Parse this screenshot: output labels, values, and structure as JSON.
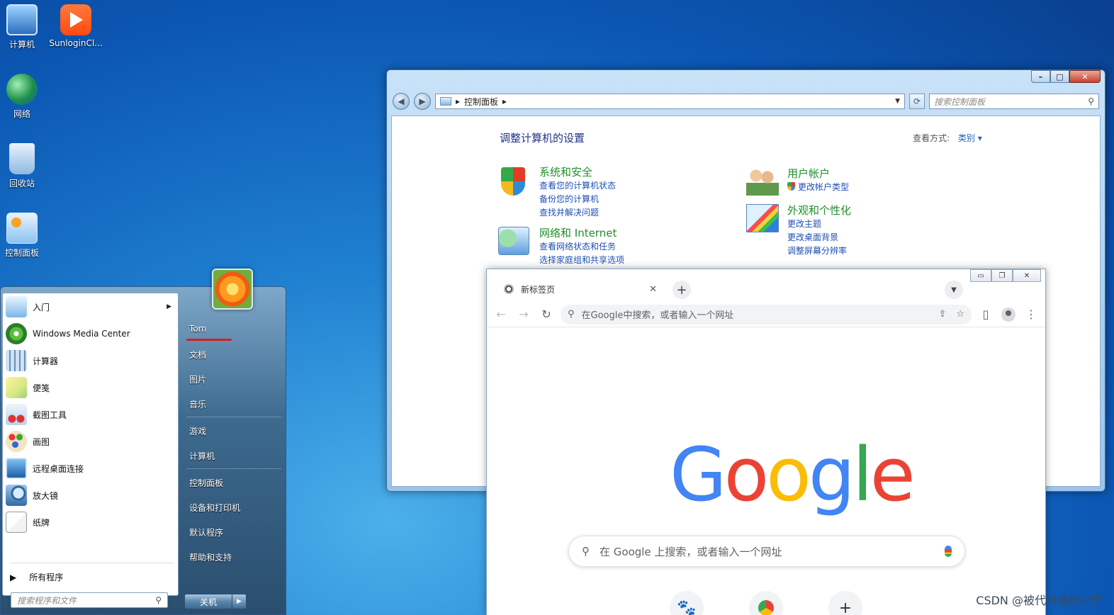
{
  "desktop": {
    "icons": [
      {
        "label": "计算机"
      },
      {
        "label": "SunloginCl..."
      },
      {
        "label": "网络"
      },
      {
        "label": "回收站"
      },
      {
        "label": "控制面板"
      }
    ]
  },
  "control_panel": {
    "breadcrumb": "控制面板",
    "search_placeholder": "搜索控制面板",
    "title": "调整计算机的设置",
    "view_by_label": "查看方式:",
    "view_by_value": "类别",
    "categories": [
      {
        "title": "系统和安全",
        "links": [
          "查看您的计算机状态",
          "备份您的计算机",
          "查找并解决问题"
        ]
      },
      {
        "title": "网络和 Internet",
        "links": [
          "查看网络状态和任务",
          "选择家庭组和共享选项"
        ]
      },
      {
        "title": "用户帐户",
        "links": [
          "更改帐户类型"
        ]
      },
      {
        "title": "外观和个性化",
        "links": [
          "更改主题",
          "更改桌面背景",
          "调整屏幕分辨率"
        ]
      }
    ]
  },
  "chrome": {
    "tab_title": "新标签页",
    "omnibox_placeholder": "在Google中搜索，或者输入一个网址",
    "logo_letters": [
      "G",
      "o",
      "o",
      "g",
      "l",
      "e"
    ],
    "search_placeholder": "在 Google 上搜索，或者输入一个网址"
  },
  "start_menu": {
    "programs": [
      {
        "label": "入门",
        "has_submenu": true
      },
      {
        "label": "Windows Media Center"
      },
      {
        "label": "计算器"
      },
      {
        "label": "便笺"
      },
      {
        "label": "截图工具"
      },
      {
        "label": "画图"
      },
      {
        "label": "远程桌面连接"
      },
      {
        "label": "放大镜"
      },
      {
        "label": "纸牌"
      }
    ],
    "all_programs": "所有程序",
    "search_placeholder": "搜索程序和文件",
    "user_name": "Tom",
    "right_items": [
      "文档",
      "图片",
      "音乐",
      "游戏",
      "计算机",
      "控制面板",
      "设备和打印机",
      "默认程序",
      "帮助和支持"
    ],
    "shutdown_label": "关机"
  },
  "watermark": "CSDN @被代码撸的小宇",
  "colors": {
    "google_blue": "#4285f4",
    "google_red": "#ea4335",
    "google_yellow": "#fbbc05",
    "google_green": "#34a853",
    "cp_category_green": "#1f8f2b",
    "cp_link_blue": "#1e4fb2"
  }
}
